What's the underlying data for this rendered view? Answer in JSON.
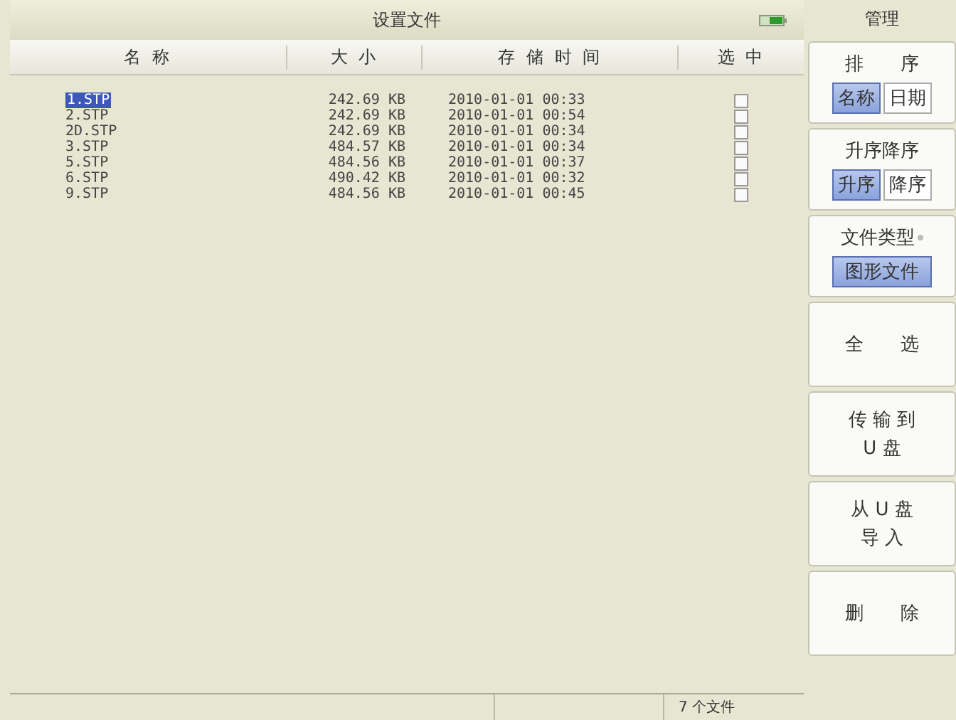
{
  "window": {
    "title": "设置文件"
  },
  "table": {
    "columns": [
      "名 称",
      "大 小",
      "存 储 时 间",
      "选 中"
    ],
    "rows": [
      {
        "name": "1.STP",
        "size": "242.69 KB",
        "time": "2010-01-01 00:33",
        "checked": false,
        "selected": true
      },
      {
        "name": "2.STP",
        "size": "242.69 KB",
        "time": "2010-01-01 00:54",
        "checked": false,
        "selected": false
      },
      {
        "name": "2D.STP",
        "size": "242.69 KB",
        "time": "2010-01-01 00:34",
        "checked": false,
        "selected": false
      },
      {
        "name": "3.STP",
        "size": "484.57 KB",
        "time": "2010-01-01 00:34",
        "checked": false,
        "selected": false
      },
      {
        "name": "5.STP",
        "size": "484.56 KB",
        "time": "2010-01-01 00:37",
        "checked": false,
        "selected": false
      },
      {
        "name": "6.STP",
        "size": "490.42 KB",
        "time": "2010-01-01 00:32",
        "checked": false,
        "selected": false
      },
      {
        "name": "9.STP",
        "size": "484.56 KB",
        "time": "2010-01-01 00:45",
        "checked": false,
        "selected": false
      }
    ]
  },
  "status_bar": {
    "file_count": "7 个文件"
  },
  "sidebar": {
    "title": "管理",
    "panels": [
      {
        "kind": "toggle",
        "title": "排　　序",
        "options": [
          {
            "label": "名称",
            "selected": true
          },
          {
            "label": "日期",
            "selected": false
          }
        ]
      },
      {
        "kind": "toggle",
        "title": "升序降序",
        "options": [
          {
            "label": "升序",
            "selected": true
          },
          {
            "label": "降序",
            "selected": false
          }
        ]
      },
      {
        "kind": "dropdown",
        "title": "文件类型",
        "value": "图形文件"
      },
      {
        "kind": "button",
        "lines": [
          "全　　选"
        ]
      },
      {
        "kind": "button",
        "lines": [
          "传 输 到",
          "U 盘"
        ]
      },
      {
        "kind": "button",
        "lines": [
          "从 U 盘",
          "导 入"
        ]
      },
      {
        "kind": "button",
        "lines": [
          "删　　除"
        ]
      }
    ]
  }
}
